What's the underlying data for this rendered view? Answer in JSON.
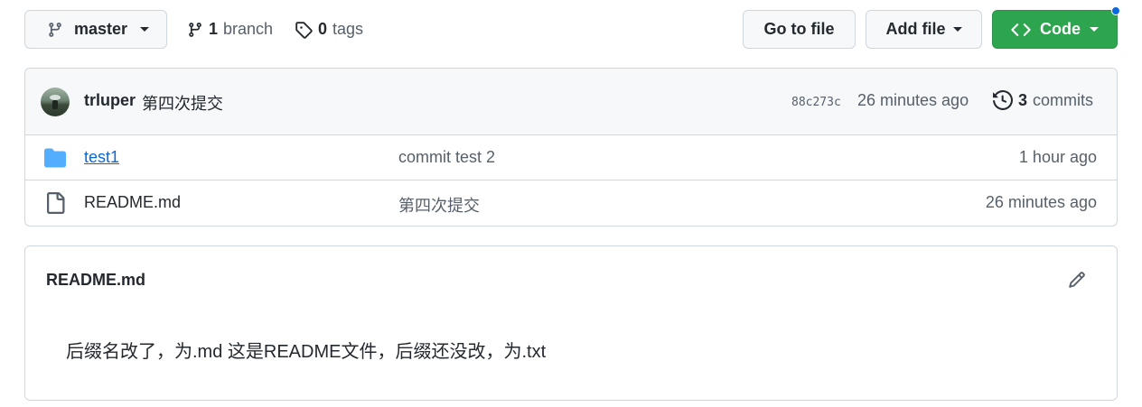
{
  "toolbar": {
    "branch_label": "master",
    "branch_count": "1",
    "branch_word": "branch",
    "tag_count": "0",
    "tag_word": "tags",
    "go_to_file": "Go to file",
    "add_file": "Add file",
    "code": "Code",
    "code_color": "#2da44e"
  },
  "latest_commit": {
    "author": "trluper",
    "message": "第四次提交",
    "sha": "88c273c",
    "time": "26 minutes ago",
    "commit_count": "3",
    "commit_word": "commits"
  },
  "files": [
    {
      "name": "test1",
      "type": "dir",
      "icon": "folder-icon",
      "message": "commit test 2",
      "age": "1 hour ago"
    },
    {
      "name": "README.md",
      "type": "file",
      "icon": "file-icon",
      "message": "第四次提交",
      "age": "26 minutes ago"
    }
  ],
  "readme": {
    "title": "README.md",
    "content": "后缀名改了，为.md 这是README文件，后缀还没改，为.txt"
  }
}
